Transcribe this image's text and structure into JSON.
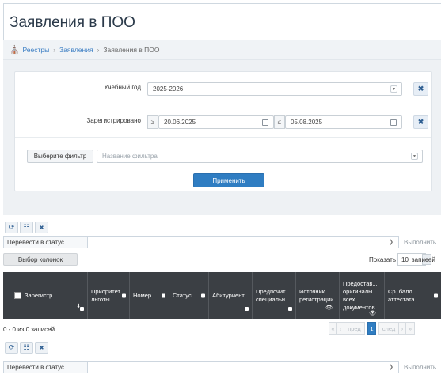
{
  "page": {
    "title": "Заявления в ПОО"
  },
  "breadcrumb": {
    "items": [
      "Реестры",
      "Заявления",
      "Заявления в ПОО"
    ],
    "separator": "›"
  },
  "filters": {
    "year_label": "Учебный год",
    "year_value": "2025-2026",
    "registered_label": "Зарегистрировано",
    "from_op": "≥",
    "from_value": "20.06.2025",
    "to_op": "≤",
    "to_value": "05.08.2025",
    "choose_filter_label": "Выберите фильтр",
    "filter_name_placeholder": "Название фильтра",
    "apply_label": "Применить",
    "clear_glyph": "✖"
  },
  "toolbar": {
    "refresh_glyph": "⟳",
    "grid_glyph": "☷",
    "close_glyph": "✖",
    "status_caption": "Перевести в статус",
    "execute_label": "Выполнить",
    "columns_label": "Выбор колонок",
    "show_label": "Показать",
    "show_value": "10",
    "records_label": "записей"
  },
  "table": {
    "columns": [
      "Зарегистр...",
      "Приоритет льготы",
      "Номер",
      "Статус",
      "Абитуриент",
      "Предпочит... специальн...",
      "Источник регистрации",
      "Предостав... оригиналы всех документов",
      "Ср. балл аттестата"
    ],
    "sort_arrow": "⬇",
    "eye_glyph": "👁",
    "summary": "0 - 0 из 0 записей"
  },
  "pagination": {
    "prev_label": "пред",
    "current_page": "1",
    "next_label": "след",
    "first_glyph": "«",
    "prev_glyph": "‹",
    "next_glyph": "›",
    "last_glyph": "»"
  },
  "bottom_toolbar": {
    "status_caption": "Перевести в статус",
    "execute_label": "Выполнить"
  },
  "colors": {
    "accent": "#2f7dc2",
    "header_dark": "#3b3f44",
    "link": "#3d7fc4"
  }
}
